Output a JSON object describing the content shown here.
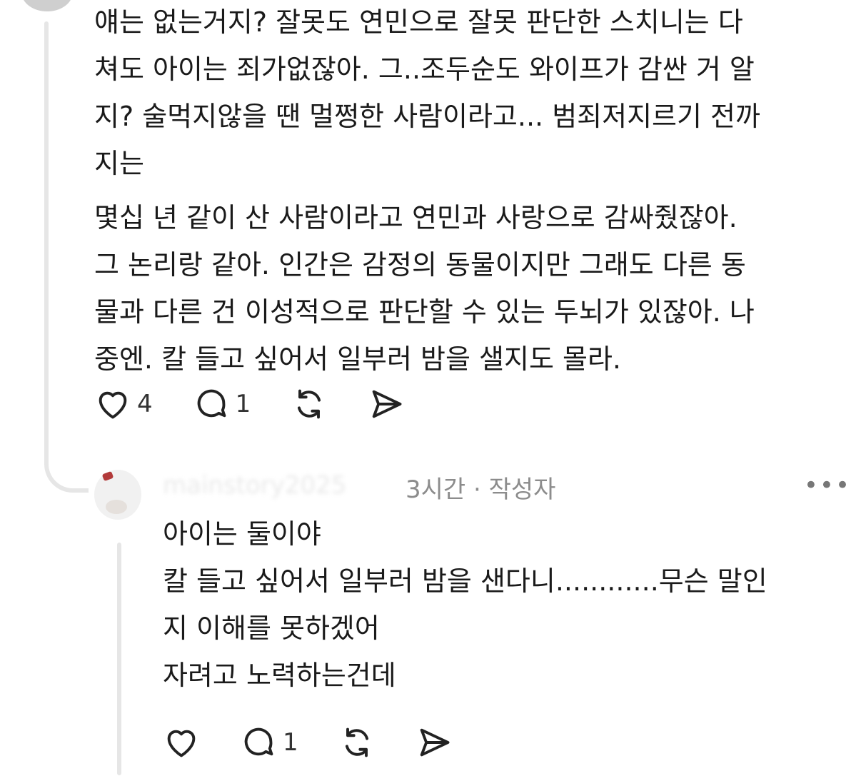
{
  "comment1": {
    "paragraph1": [
      "얘는 없는거지? 잘못도 연민으로 잘못 판단한 스치니는 다",
      "쳐도 아이는 죄가없잖아. 그..조두순도 와이프가 감싼 거 알",
      "지? 술먹지않을 땐 멀쩡한 사람이라고... 범죄저지르기 전까",
      "지는"
    ],
    "paragraph2": [
      "몇십 년 같이 산 사람이라고 연민과 사랑으로 감싸줬잖아.",
      "그 논리랑 같아. 인간은 감정의 동물이지만 그래도 다른 동",
      "물과 다른 건 이성적으로 판단할 수 있는 두뇌가 있잖아. 나",
      "중엔. 칼 들고 싶어서 일부러 밤을 샐지도 몰라."
    ],
    "likes": "4",
    "replies": "1"
  },
  "reply": {
    "username": "mainstory2025",
    "meta": "3시간 · 작성자",
    "more": "•••",
    "lines": [
      "아이는 둘이야",
      "칼 들고 싶어서 일부러 밤을 샌다니............무슨 말인",
      "지 이해를 못하겠어",
      "자려고 노력하는건데"
    ],
    "replies": "1"
  },
  "icons": {
    "like": "heart-icon",
    "reply": "speech-bubble-icon",
    "repost": "repost-icon",
    "share": "send-icon"
  }
}
